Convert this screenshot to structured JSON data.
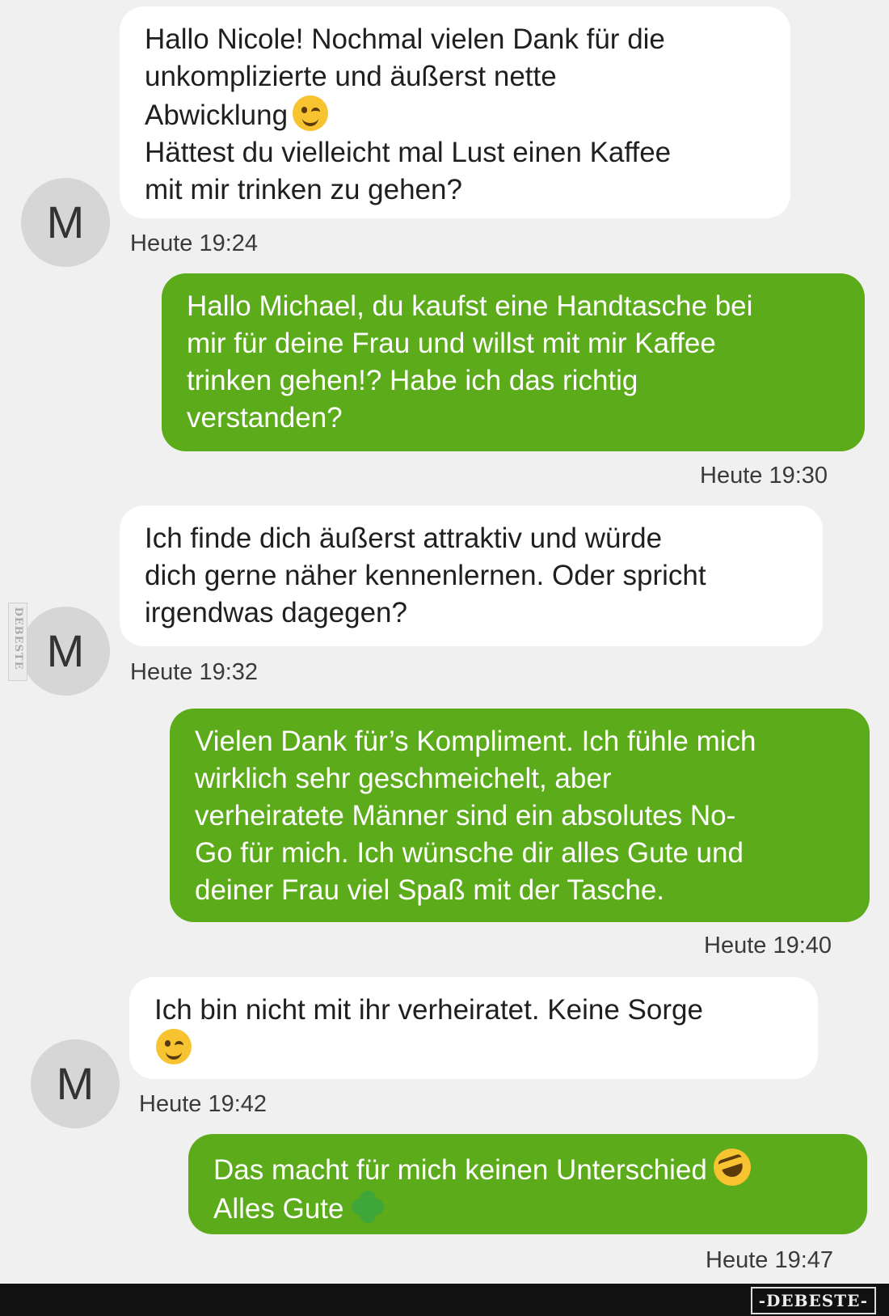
{
  "messages": [
    {
      "sender": "M",
      "direction": "incoming",
      "text": "Hallo Nicole! Nochmal vielen Dank für die\nunkomplizierte und äußerst nette\nAbwicklung",
      "text_after_emoji": "\nHättest du vielleicht mal Lust einen Kaffee\nmit mir trinken zu gehen?",
      "emoji": "winking-face",
      "time": "Heute 19:24"
    },
    {
      "direction": "outgoing",
      "text": "Hallo Michael, du kaufst eine Handtasche bei\nmir für deine Frau und willst mit mir Kaffee\ntrinken gehen!? Habe ich das richtig\nverstanden?",
      "time": "Heute 19:30"
    },
    {
      "sender": "M",
      "direction": "incoming",
      "text": "Ich finde dich äußerst attraktiv und würde\ndich gerne näher kennenlernen. Oder spricht\nirgendwas dagegen?",
      "time": "Heute 19:32"
    },
    {
      "direction": "outgoing",
      "text": "Vielen Dank für’s Kompliment. Ich fühle mich\nwirklich sehr geschmeichelt, aber\nverheiratete Männer sind ein absolutes No-\nGo für mich. Ich wünsche dir alles Gute und\ndeiner Frau viel Spaß mit der Tasche.",
      "time": "Heute 19:40"
    },
    {
      "sender": "M",
      "direction": "incoming",
      "text": "Ich bin nicht mit ihr verheiratet. Keine Sorge",
      "emoji": "winking-face",
      "time": "Heute 19:42"
    },
    {
      "direction": "outgoing",
      "text": "Das macht für mich keinen Unterschied",
      "emoji": "rolling-on-floor-laughing-face",
      "text_line2": "Alles Gute",
      "emoji2": "four-leaf-clover",
      "time": "Heute 19:47"
    }
  ],
  "watermark": {
    "side": "DEBESTE",
    "footer": "-DEBESTE-"
  },
  "colors": {
    "incoming_bubble": "#ffffff",
    "outgoing_bubble": "#5cab1a",
    "background": "#f0f0f0",
    "avatar": "#d6d6d6"
  }
}
